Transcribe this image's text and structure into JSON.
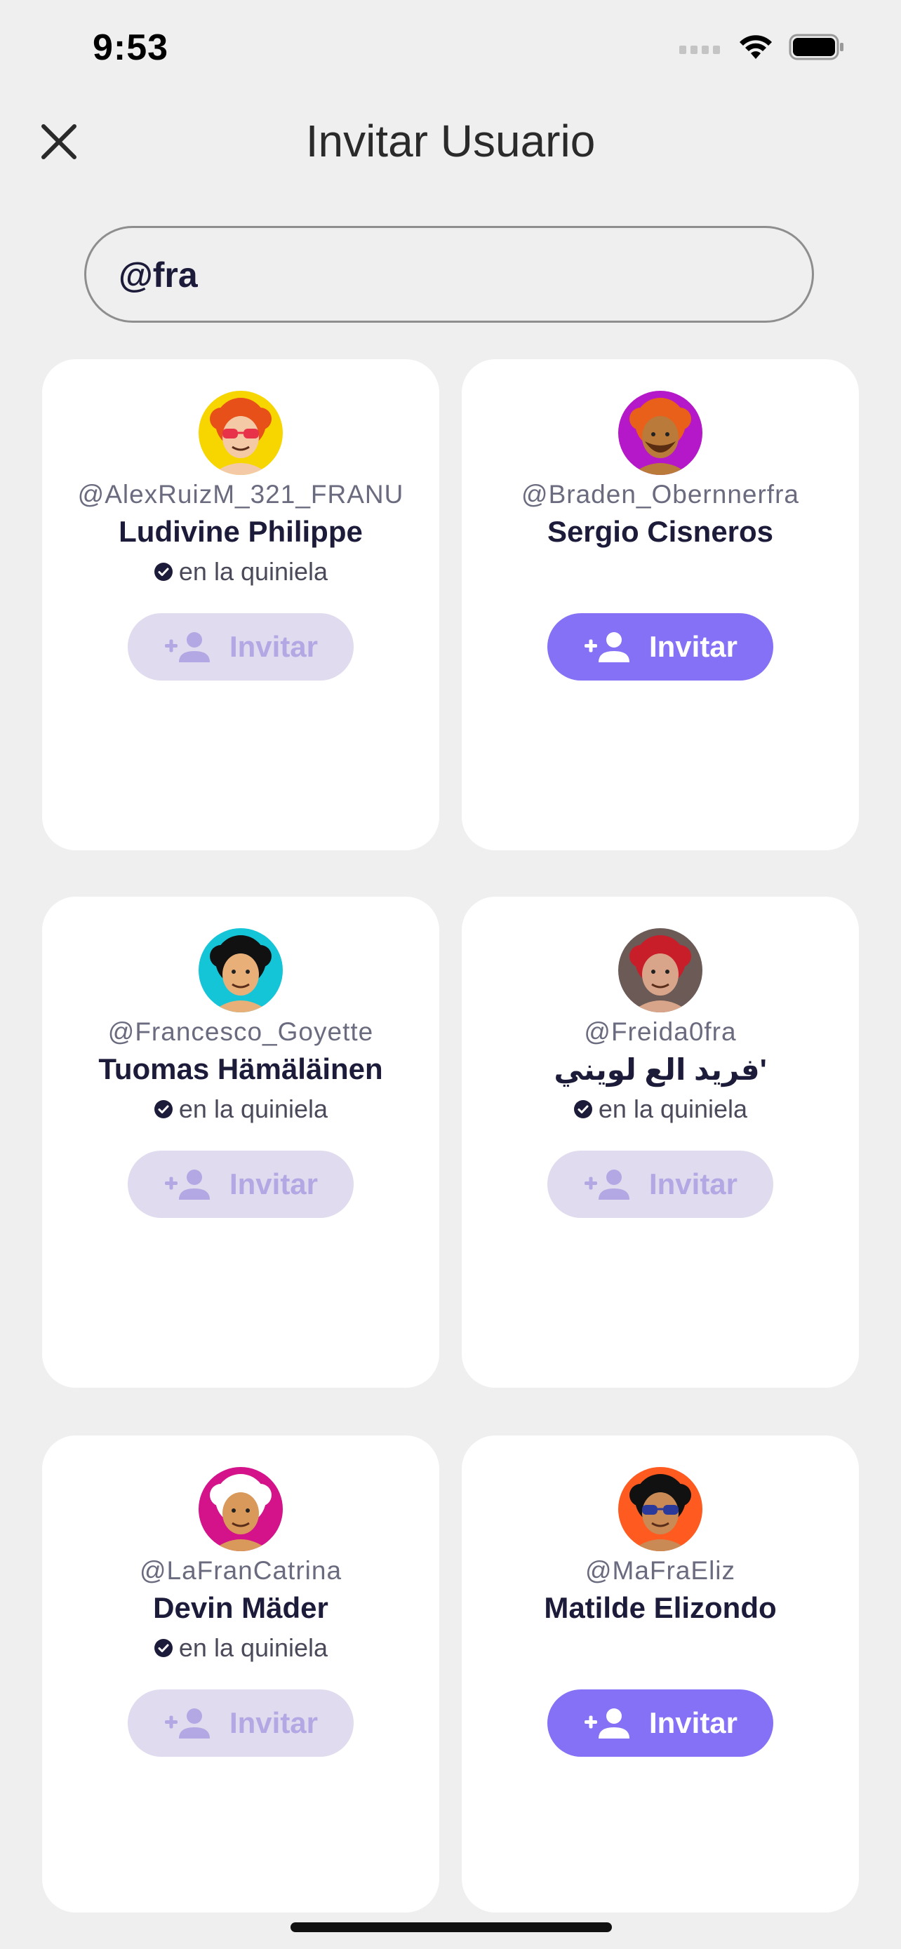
{
  "status_bar": {
    "time": "9:53"
  },
  "header": {
    "title": "Invitar Usuario"
  },
  "search": {
    "value": "@fra"
  },
  "colors": {
    "accent": "#8471f6",
    "disabled_bg": "#e0dbee",
    "disabled_text": "#b3a8e3",
    "verified": "#1d1b3a"
  },
  "users": [
    {
      "username": "@AlexRuizM_321_FRANU",
      "name": "Ludivine Philippe",
      "status": "en la quiniela",
      "invite_label": "Invitar",
      "invited": true,
      "avatar_bg": "#f7d600",
      "hair": "#e8501a",
      "skin": "#f4c9a6",
      "accessory": "glasses-red"
    },
    {
      "username": "@Braden_Obernnerfra",
      "name": "Sergio Cisneros",
      "status": "",
      "invite_label": "Invitar",
      "invited": false,
      "avatar_bg": "#b418c9",
      "hair": "#e8601a",
      "skin": "#b97a3a",
      "accessory": "beard"
    },
    {
      "username": "@Francesco_Goyette",
      "name": "Tuomas Hämäläinen",
      "status": "en la quiniela",
      "invite_label": "Invitar",
      "invited": true,
      "avatar_bg": "#14c5d8",
      "hair": "#111111",
      "skin": "#e8b078",
      "accessory": "smile"
    },
    {
      "username": "@Freida0fra",
      "name": "فريد الع لويني'",
      "status": "en la quiniela",
      "invite_label": "Invitar",
      "invited": true,
      "avatar_bg": "#6b5a55",
      "hair": "#c81e2a",
      "skin": "#d9a58a",
      "accessory": "photo"
    },
    {
      "username": "@LaFranCatrina",
      "name": "Devin Mäder",
      "status": "en la quiniela",
      "invite_label": "Invitar",
      "invited": true,
      "avatar_bg": "#d4128a",
      "hair": "#ffffff",
      "skin": "#d9995a",
      "accessory": "bald"
    },
    {
      "username": "@MaFraEliz",
      "name": "Matilde Elizondo",
      "status": "",
      "invite_label": "Invitar",
      "invited": false,
      "avatar_bg": "#ff5a1f",
      "hair": "#111111",
      "skin": "#c98a55",
      "accessory": "glasses-blue"
    }
  ]
}
